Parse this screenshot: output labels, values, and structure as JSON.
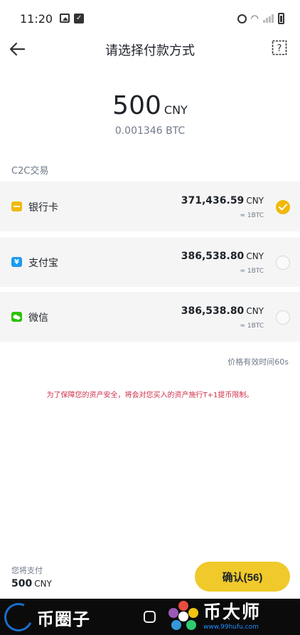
{
  "status_bar": {
    "time": "11:20"
  },
  "header": {
    "title": "请选择付款方式"
  },
  "amount": {
    "value": "500",
    "currency": "CNY",
    "btc": "0.001346 BTC"
  },
  "section_label": "C2C交易",
  "payment_methods": [
    {
      "label": "银行卡",
      "price": "371,436.59",
      "currency": "CNY",
      "rate": "≈ 1BTC",
      "selected": true,
      "icon": "bank-card-icon",
      "color": "#f0b90b"
    },
    {
      "label": "支付宝",
      "price": "386,538.80",
      "currency": "CNY",
      "rate": "≈ 1BTC",
      "selected": false,
      "icon": "alipay-icon",
      "color": "#1a9bf0"
    },
    {
      "label": "微信",
      "price": "386,538.80",
      "currency": "CNY",
      "rate": "≈ 1BTC",
      "selected": false,
      "icon": "wechat-icon",
      "color": "#2dc100"
    }
  ],
  "validity": "价格有效时间60s",
  "notice": "为了保障您的资产安全，将会对您买入的资产施行T+1提币限制。",
  "footer": {
    "pay_label": "您将支付",
    "pay_amount": "500",
    "pay_currency": "CNY",
    "confirm": "确认(56)"
  },
  "watermarks": {
    "left": "币圈子",
    "right": "币大师",
    "right_url": "www.99hufu.com"
  },
  "colors": {
    "accent": "#f0b90b",
    "notice": "#cf304a"
  }
}
